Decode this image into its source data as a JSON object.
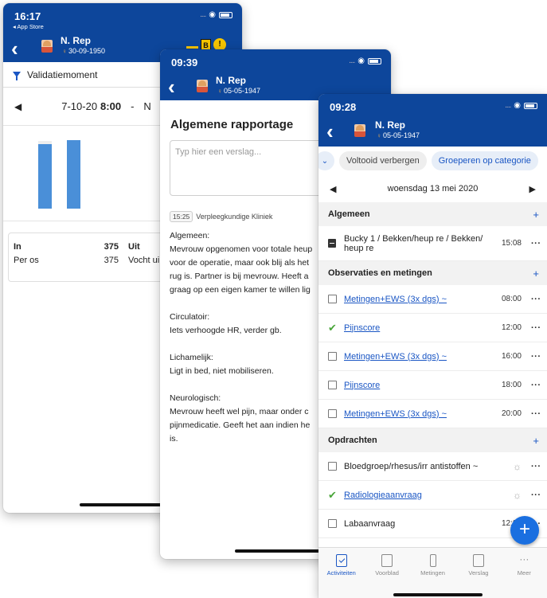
{
  "screens": {
    "validation": {
      "status_time": "16:17",
      "back_to_app": "◂ App Store",
      "patient_name": "N. Rep",
      "patient_dob": "30-09-1950",
      "badge_letter": "B",
      "badge_info": "!",
      "filter_label": "Validatiemoment",
      "date_label": "7-10-20",
      "date_time": "8:00",
      "date_sep": "-",
      "date_next": "N",
      "io_rows": [
        {
          "label": "In",
          "value": "375",
          "other": "Uit"
        },
        {
          "label": "Per os",
          "value": "375",
          "other": "Vocht ui"
        }
      ]
    },
    "report": {
      "status_time": "09:39",
      "patient_name": "N. Rep",
      "patient_dob": "05-05-1947",
      "title": "Algemene rapportage",
      "input_placeholder": "Typ hier een verslag...",
      "entry_time": "15:25",
      "entry_author": "Verpleegkundige Kliniek",
      "paragraphs": [
        {
          "heading": "Algemeen:",
          "lines": [
            "Mevrouw opgenomen voor totale heup",
            "voor de operatie, maar ook blij als het",
            "rug is. Partner is bij mevrouw. Heeft a",
            "graag op een eigen kamer te willen lig"
          ]
        },
        {
          "heading": "Circulatoir:",
          "lines": [
            "Iets verhoogde HR, verder gb."
          ]
        },
        {
          "heading": "Lichamelijk:",
          "lines": [
            "Ligt in bed, niet mobiliseren."
          ]
        },
        {
          "heading": "Neurologisch:",
          "lines": [
            "Mevrouw heeft wel pijn, maar onder c",
            "pijnmedicatie. Geeft het aan indien he",
            "is."
          ]
        }
      ]
    },
    "activities": {
      "status_time": "09:28",
      "patient_name": "N. Rep",
      "patient_dob": "05-05-1947",
      "chip_hide": "Voltooid verbergen",
      "chip_group": "Groeperen op categorie",
      "date": "woensdag 13 mei 2020",
      "sections": [
        {
          "title": "Algemeen",
          "items": [
            {
              "label": "Bucky 1 / Bekken/heup re / Bekken/ heup re",
              "time": "15:08",
              "state": "xray",
              "link": false
            }
          ]
        },
        {
          "title": "Observaties en metingen",
          "items": [
            {
              "label": "Metingen+EWS (3x dgs) ~",
              "time": "08:00",
              "state": "open",
              "link": true
            },
            {
              "label": "Pijnscore",
              "time": "12:00",
              "state": "done",
              "link": true
            },
            {
              "label": "Metingen+EWS (3x dgs) ~",
              "time": "16:00",
              "state": "open",
              "link": true
            },
            {
              "label": "Pijnscore",
              "time": "18:00",
              "state": "open",
              "link": true
            },
            {
              "label": "Metingen+EWS (3x dgs) ~",
              "time": "20:00",
              "state": "open",
              "link": true
            }
          ]
        },
        {
          "title": "Opdrachten",
          "items": [
            {
              "label": "Bloedgroep/rhesus/irr antistoffen ~",
              "time": "",
              "state": "open",
              "link": false
            },
            {
              "label": "Radiologieaanvraag",
              "time": "",
              "state": "done",
              "link": true
            },
            {
              "label": "Labaanvraag",
              "time": "12:25",
              "state": "open",
              "link": false
            }
          ]
        }
      ],
      "tabs": [
        {
          "label": "Activiteiten",
          "active": true
        },
        {
          "label": "Voorblad",
          "active": false
        },
        {
          "label": "Metingen",
          "active": false
        },
        {
          "label": "Verslag",
          "active": false
        },
        {
          "label": "Meer",
          "active": false
        }
      ]
    }
  },
  "chart_bars": [
    {
      "fill": 0.88,
      "cap": 0.04
    },
    {
      "fill": 0.94,
      "cap": 0.0
    }
  ],
  "colors": {
    "header": "#0d469b",
    "accent": "#1a56c4",
    "bar": "#4a8fd8",
    "done": "#4aa63a"
  }
}
